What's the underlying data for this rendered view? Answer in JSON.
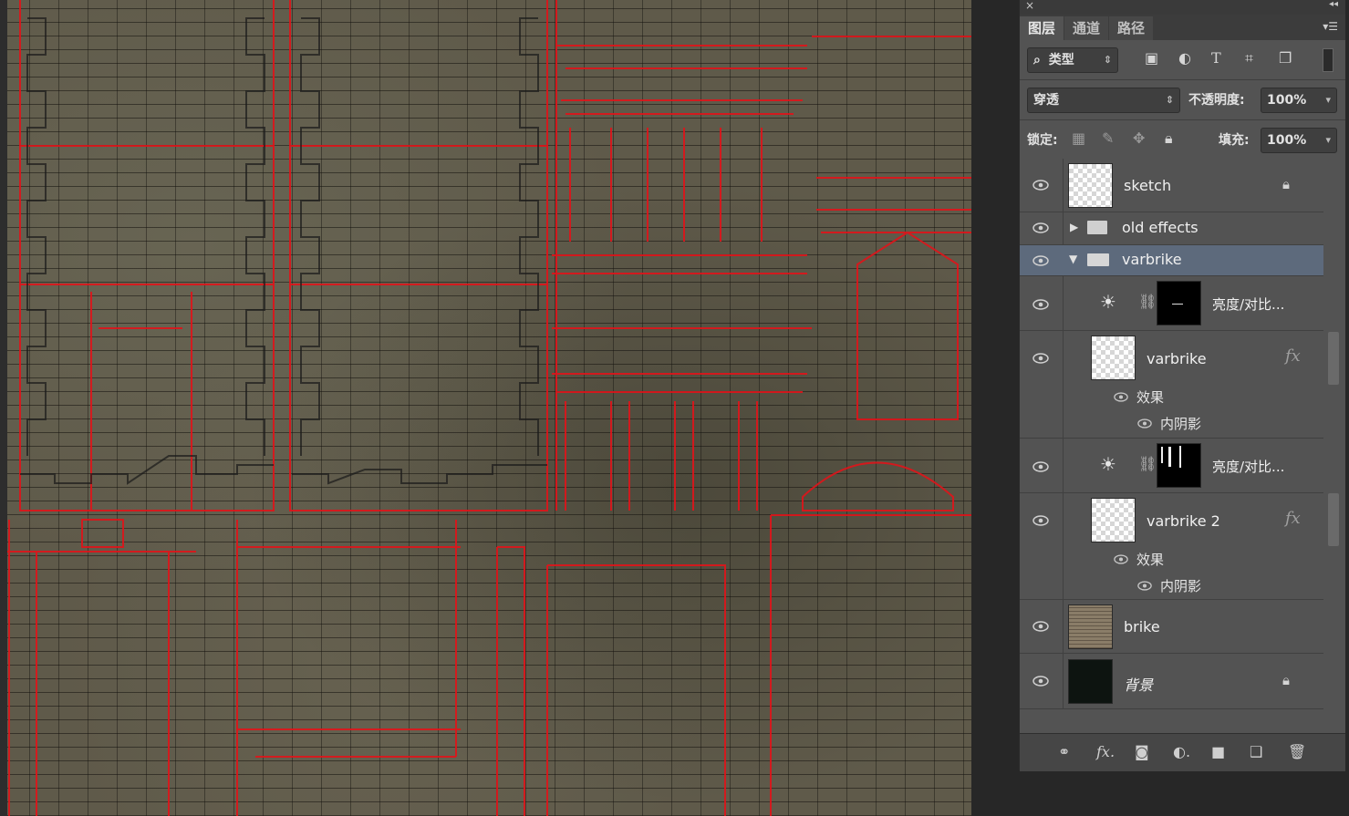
{
  "panel": {
    "close_glyph": "×",
    "collapse_glyph": "◂◂",
    "tabs": [
      {
        "label": "图层"
      },
      {
        "label": "通道"
      },
      {
        "label": "路径"
      }
    ],
    "menu_icon": "panel-menu-icon",
    "filter": {
      "search_glyph": "⌕",
      "label": "类型"
    },
    "blend_mode": "穿透",
    "opacity_label": "不透明度:",
    "opacity_value": "100%",
    "lock_label": "锁定:",
    "fill_label": "填充:",
    "fill_value": "100%"
  },
  "layers": [
    {
      "name": "sketch",
      "type": "layer",
      "locked": true
    },
    {
      "name": "old effects",
      "type": "group",
      "expanded": false
    },
    {
      "name": "varbrike",
      "type": "group",
      "expanded": true,
      "selected": true
    },
    {
      "name": "亮度/对比...",
      "type": "adjustment"
    },
    {
      "name": "varbrike",
      "type": "layer",
      "fx": "fx",
      "effects_label": "效果",
      "effect": "内阴影"
    },
    {
      "name": "亮度/对比...",
      "type": "adjustment"
    },
    {
      "name": "varbrike 2",
      "type": "layer",
      "fx": "fx",
      "effects_label": "效果",
      "effect": "内阴影"
    },
    {
      "name": "brike",
      "type": "layer"
    },
    {
      "name": "背景",
      "type": "layer",
      "locked": true
    }
  ],
  "colors": {
    "panel_bg": "#535353",
    "selected_row": "#5d6a7c",
    "sketch_line": "#e0141a",
    "canvas_bg": "#5f5a4a"
  },
  "bottom_icons": [
    "link-icon",
    "fx-icon",
    "mask-icon",
    "adjustment-icon",
    "folder-icon",
    "new-layer-icon",
    "trash-icon"
  ]
}
